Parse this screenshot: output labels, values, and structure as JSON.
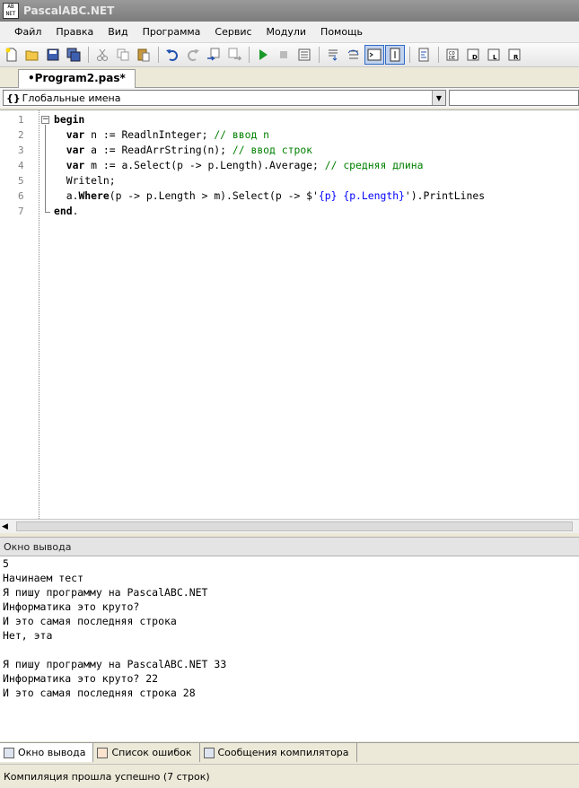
{
  "window": {
    "title": "PascalABC.NET",
    "icon": "pascal-app-icon"
  },
  "menu": [
    "Файл",
    "Правка",
    "Вид",
    "Программа",
    "Сервис",
    "Модули",
    "Помощь"
  ],
  "toolbar": {
    "icons": [
      "new-file-icon",
      "open-folder-icon",
      "save-icon",
      "save-all-icon",
      "cut-icon",
      "copy-icon",
      "paste-icon",
      "undo-icon",
      "redo-icon",
      "navigate-back-icon",
      "navigate-forward-icon",
      "run-icon",
      "stop-icon",
      "debug-window-icon",
      "step-into-icon",
      "step-over-icon",
      "output-window-icon",
      "text-input-icon",
      "format-code-icon",
      "cancel-compile-icon",
      "module-d-icon",
      "module-l-icon",
      "module-r-icon"
    ]
  },
  "tab": {
    "label": "•Program2.pas*"
  },
  "scope": {
    "braces": "{}",
    "label": "Глобальные имена"
  },
  "editor": {
    "lines": [
      {
        "num": "1",
        "segments": [
          {
            "t": "begin",
            "c": "kw"
          }
        ]
      },
      {
        "num": "2",
        "segments": [
          {
            "t": "  "
          },
          {
            "t": "var",
            "c": "kw"
          },
          {
            "t": " n := ReadlnInteger; "
          },
          {
            "t": "// ввод n",
            "c": "cm"
          }
        ]
      },
      {
        "num": "3",
        "segments": [
          {
            "t": "  "
          },
          {
            "t": "var",
            "c": "kw"
          },
          {
            "t": " a := ReadArrString(n); "
          },
          {
            "t": "// ввод строк",
            "c": "cm"
          }
        ]
      },
      {
        "num": "4",
        "segments": [
          {
            "t": "  "
          },
          {
            "t": "var",
            "c": "kw"
          },
          {
            "t": " m := a.Select(p -> p.Length).Average; "
          },
          {
            "t": "// средняя длина",
            "c": "cm"
          }
        ]
      },
      {
        "num": "5",
        "segments": [
          {
            "t": "  Writeln;"
          }
        ]
      },
      {
        "num": "6",
        "segments": [
          {
            "t": "  a."
          },
          {
            "t": "Where",
            "c": "kw"
          },
          {
            "t": "(p -> p.Length > m).Select(p -> $'"
          },
          {
            "t": "{p} {p.Length}",
            "c": "st"
          },
          {
            "t": "').PrintLines"
          }
        ]
      },
      {
        "num": "7",
        "segments": [
          {
            "t": "end",
            "c": "kw"
          },
          {
            "t": "."
          }
        ]
      }
    ]
  },
  "output": {
    "header": "Окно вывода",
    "lines": [
      "5",
      "Начинаем тест",
      "Я пишу программу на PascalABC.NET",
      "Информатика это круто?",
      "И это самая последняя строка",
      "Нет, эта",
      "",
      "Я пишу программу на PascalABC.NET 33",
      "Информатика это круто? 22",
      "И это самая последняя строка 28"
    ]
  },
  "bottom_tabs": [
    {
      "label": "Окно вывода",
      "active": true
    },
    {
      "label": "Список ошибок",
      "active": false
    },
    {
      "label": "Сообщения компилятора",
      "active": false
    }
  ],
  "status": "Компиляция прошла успешно (7 строк)"
}
